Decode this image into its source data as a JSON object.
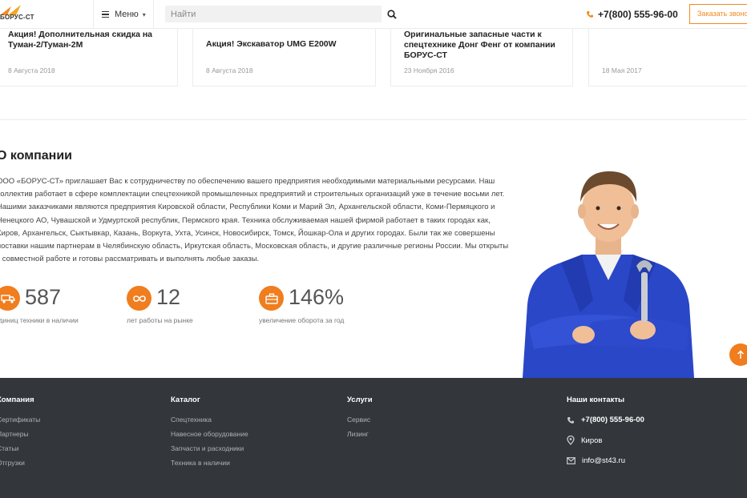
{
  "header": {
    "logo_text": "БОРУС-СТ",
    "menu_label": "Меню",
    "search_placeholder": "Найти",
    "phone": "+7(800) 555-96-00",
    "call_button": "Заказать звонок"
  },
  "news": [
    {
      "title": "Акция! Дополнительная скидка на Туман-2/Туман-2М",
      "date": "8 Августа 2018"
    },
    {
      "title": "Акция! Экскаватор UMG E200W",
      "date": "8 Августа 2018"
    },
    {
      "title": "Оригинальные запасные части к спецтехнике Донг Фенг от компании БОРУС-СТ",
      "date": "23 Ноября 2016"
    },
    {
      "title": "",
      "date": "18 Мая 2017"
    }
  ],
  "about": {
    "title": "О компании",
    "text": "ООО «БОРУС-СТ» приглашает Вас к сотрудничеству по обеспечению вашего предприятия необходимыми материальными ресурсами. Наш коллектив работает в сфере комплектации спецтехникой промышленных предприятий и строительных организаций уже в течение восьми лет. Нашими заказчиками являются предприятия Кировской области, Республики Коми и Марий Эл, Архангельской области, Коми-Пермяцкого и Ненецкого АО, Чувашской и Удмуртской республик, Пермского края. Техника обслуживаемая нашей фирмой работает в таких городах как, Киров, Архангельск, Сыктывкар, Казань, Воркута, Ухта, Усинск, Новосибирск, Томск, Йошкар-Ола и других городах. Были так же совершены поставки нашим партнерам в Челябинскую область, Иркутская область, Московская область, и другие различные регионы России. Мы открыты к совместной работе и готовы рассматривать и выполнять любые заказы."
  },
  "stats": [
    {
      "value": "587",
      "label": "единиц техники в наличии",
      "icon": "truck-icon"
    },
    {
      "value": "12",
      "label": "лет работы на рынке",
      "icon": "infinity-icon"
    },
    {
      "value": "146%",
      "label": "увеличение оборота за год",
      "icon": "briefcase-icon"
    }
  ],
  "footer": {
    "company": {
      "title": "Компания",
      "links": [
        "Сертификаты",
        "Партнеры",
        "Статьи",
        "Отгрузки"
      ]
    },
    "catalog": {
      "title": "Каталог",
      "links": [
        "Спецтехника",
        "Навесное оборудование",
        "Запчасти и расходники",
        "Техника в наличии"
      ]
    },
    "services": {
      "title": "Услуги",
      "links": [
        "Сервис",
        "Лизинг"
      ]
    },
    "contacts": {
      "title": "Наши контакты",
      "phone": "+7(800) 555-96-00",
      "city": "Киров",
      "email": "info@st43.ru"
    }
  },
  "colors": {
    "accent": "#f07d1e",
    "footer_bg": "#33373c"
  }
}
